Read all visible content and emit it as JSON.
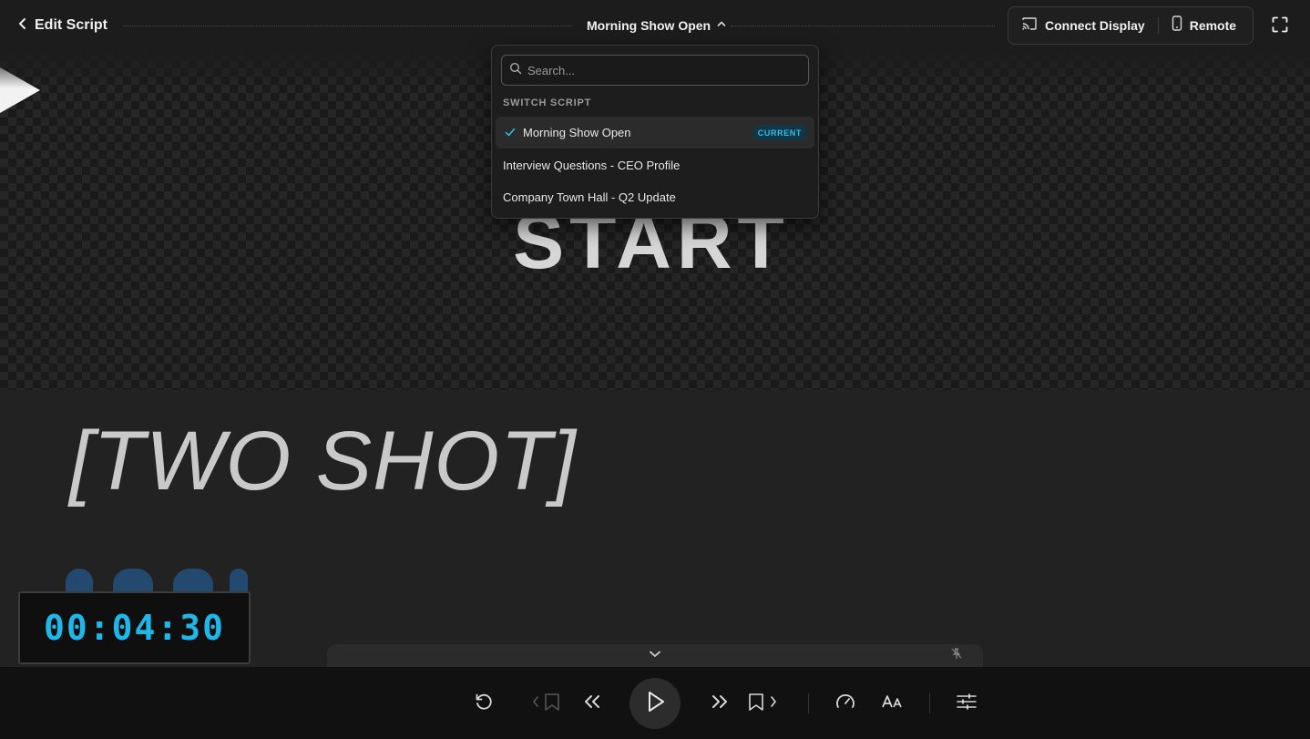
{
  "header": {
    "back_label": "Edit Script",
    "script_title": "Morning Show Open",
    "connect_display_label": "Connect Display",
    "remote_label": "Remote"
  },
  "stage": {
    "start_text": "START",
    "cue_text": "[TWO SHOT]"
  },
  "timer": {
    "value": "00:04:30"
  },
  "dropdown": {
    "search_placeholder": "Search...",
    "section_label": "SWITCH SCRIPT",
    "items": [
      {
        "label": "Morning Show Open",
        "badge": "CURRENT",
        "selected": true
      },
      {
        "label": "Interview Questions - CEO Profile"
      },
      {
        "label": "Company Town Hall - Q2 Update"
      }
    ]
  },
  "controls": {
    "icons": [
      "reset-icon",
      "previous-bookmark-icon",
      "rewind-icon",
      "play-icon",
      "fast-forward-icon",
      "next-bookmark-icon",
      "speed-icon",
      "text-size-icon",
      "settings-sliders-icon"
    ]
  },
  "colors": {
    "accent": "#1fb6e8",
    "badge_bg": "#123646",
    "background": "#1e1e1e"
  }
}
